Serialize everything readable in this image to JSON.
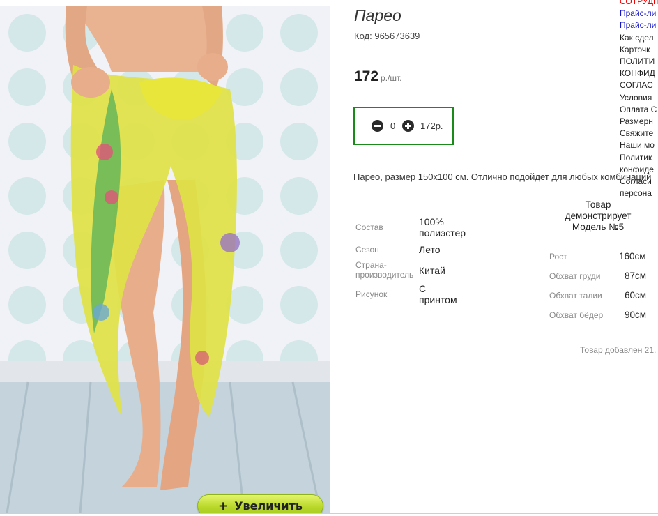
{
  "product": {
    "title": "Парео",
    "code_label": "Код:",
    "code": "965673639",
    "price": "172",
    "price_unit": "р./шт.",
    "quantity": "0",
    "total": "172р.",
    "description": "Парео, размер 150х100 см. Отлично подойдет для любых комбинаций"
  },
  "zoom_button": {
    "icon": "+",
    "label": "Увеличить"
  },
  "specs": [
    {
      "label": "Состав",
      "value": "100% полиэстер"
    },
    {
      "label": "Сезон",
      "value": "Лето"
    },
    {
      "label": "Страна-производитель",
      "value": "Китай"
    },
    {
      "label": "Рисунок",
      "value": "С принтом"
    }
  ],
  "model": {
    "heading": "Товар демонстрирует Модель №5",
    "params": [
      {
        "label": "Рост",
        "value": "160см"
      },
      {
        "label": "Обхват груди",
        "value": "87см"
      },
      {
        "label": "Обхват талии",
        "value": "60см"
      },
      {
        "label": "Обхват бёдер",
        "value": "90см"
      }
    ]
  },
  "added_date": "Товар добавлен 21.",
  "sidebar_links": [
    {
      "label": "СОТРУДН",
      "color": "#e00000"
    },
    {
      "label": "Прайс-ли",
      "color": "#1515c8"
    },
    {
      "label": "Прайс-ли",
      "color": "#1515c8"
    },
    {
      "label": "Как сдел",
      "color": "#222222"
    },
    {
      "label": "Карточк",
      "color": "#222222"
    },
    {
      "label": "ПОЛИТИ",
      "color": "#222222"
    },
    {
      "label": "КОНФИД",
      "color": "#222222"
    },
    {
      "label": "СОГЛАС",
      "color": "#222222"
    },
    {
      "label": "Условия",
      "color": "#222222"
    },
    {
      "label": "Оплата С",
      "color": "#222222"
    },
    {
      "label": "Размерн",
      "color": "#222222"
    },
    {
      "label": "Свяжите",
      "color": "#222222"
    },
    {
      "label": "Наши мо",
      "color": "#222222"
    },
    {
      "label": "Политик",
      "color": "#222222"
    },
    {
      "label": "конфиде",
      "color": "#222222"
    },
    {
      "label": "Согласи",
      "color": "#222222"
    },
    {
      "label": "персона",
      "color": "#222222"
    }
  ],
  "colors": {
    "qty_border": "#1a8a1a",
    "zoom_button": "#c5e23a",
    "link_blue": "#1515c8",
    "link_red": "#e00000"
  }
}
